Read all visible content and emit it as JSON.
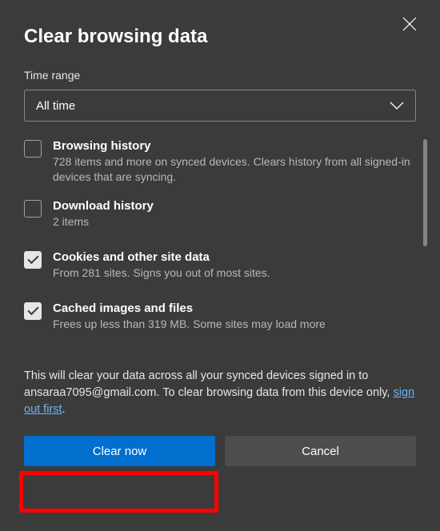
{
  "dialog": {
    "title": "Clear browsing data",
    "time_range_label": "Time range",
    "time_range_value": "All time"
  },
  "options": [
    {
      "title": "Browsing history",
      "desc": "728 items and more on synced devices. Clears history from all signed-in devices that are syncing.",
      "checked": false
    },
    {
      "title": "Download history",
      "desc": "2 items",
      "checked": false
    },
    {
      "title": "Cookies and other site data",
      "desc": "From 281 sites. Signs you out of most sites.",
      "checked": true
    },
    {
      "title": "Cached images and files",
      "desc": "Frees up less than 319 MB. Some sites may load more",
      "checked": true
    }
  ],
  "footer": {
    "text_before": "This will clear your data across all your synced devices signed in to ansaraa7095@gmail.com. To clear browsing data from this device only, ",
    "link_text": "sign out first",
    "text_after": "."
  },
  "buttons": {
    "primary": "Clear now",
    "secondary": "Cancel"
  }
}
